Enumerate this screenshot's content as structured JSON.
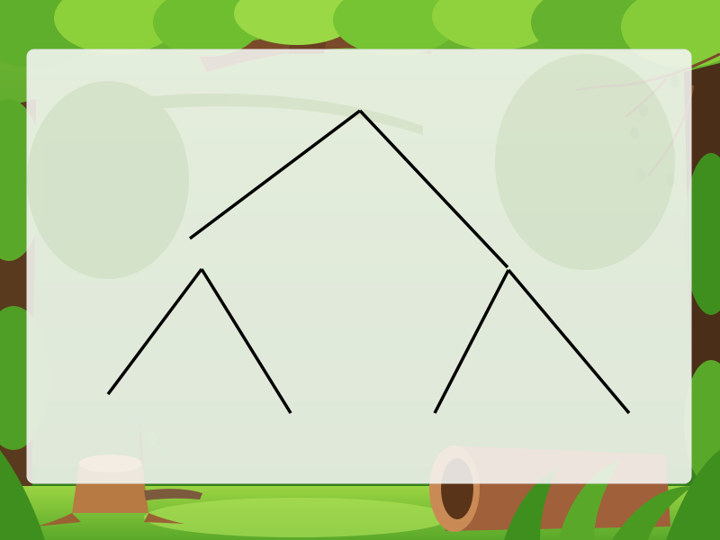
{
  "background": {
    "theme": "forest-clearing",
    "colors": {
      "grass_light": "#8fcf3c",
      "grass_dark": "#3f8f1e",
      "foliage_light": "#b6e04a",
      "foliage_dark": "#4a9a22",
      "trunk": "#7a4a2a",
      "stump": "#c48a4e",
      "log": "#9a5a32",
      "panel_fill": "#f4f4f2",
      "panel_border": "#e6e6e6"
    }
  },
  "diagram": {
    "type": "tree-branch-lines",
    "line_color": "#000000",
    "labels": []
  }
}
